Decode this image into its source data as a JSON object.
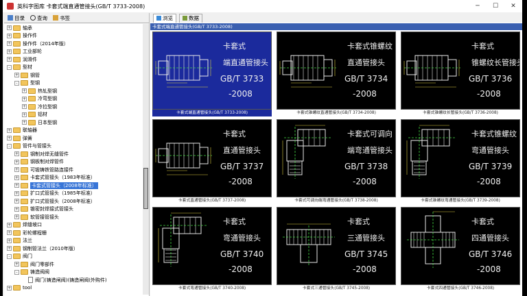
{
  "window": {
    "title": "英科字图库 卡套式端直通管接头(GB/T 3733-2008)"
  },
  "left_tabs": [
    {
      "label": "目录"
    },
    {
      "label": "查询"
    },
    {
      "label": "书签"
    }
  ],
  "tree": [
    {
      "label": "轴承",
      "exp": "+",
      "level": 0
    },
    {
      "label": "操作件",
      "exp": "+",
      "level": 0
    },
    {
      "label": "操作件（2014年版）",
      "exp": "+",
      "level": 0
    },
    {
      "label": "工业部轮",
      "exp": "+",
      "level": 0
    },
    {
      "label": "润滑件",
      "exp": "+",
      "level": 0
    },
    {
      "label": "型材",
      "exp": "-",
      "level": 0
    },
    {
      "label": "钢管",
      "exp": "+",
      "level": 1
    },
    {
      "label": "型钢",
      "exp": "-",
      "level": 1
    },
    {
      "label": "热轧型钢",
      "exp": "+",
      "level": 2
    },
    {
      "label": "冷弯型钢",
      "exp": "+",
      "level": 2
    },
    {
      "label": "冷拉型钢",
      "exp": "+",
      "level": 2
    },
    {
      "label": "铝材",
      "exp": "+",
      "level": 2
    },
    {
      "label": "日本型钢",
      "exp": "+",
      "level": 2
    },
    {
      "label": "联轴器",
      "exp": "+",
      "level": 0
    },
    {
      "label": "弹簧",
      "exp": "+",
      "level": 0
    },
    {
      "label": "管件与管接头",
      "exp": "-",
      "level": 0
    },
    {
      "label": "钢制对焊无缝管件",
      "exp": "+",
      "level": 1
    },
    {
      "label": "钢板制对焊管件",
      "exp": "+",
      "level": 1
    },
    {
      "label": "可锻铸铁管路连接件",
      "exp": "+",
      "level": 1
    },
    {
      "label": "卡套式管接头（1983年标准）",
      "exp": "+",
      "level": 1
    },
    {
      "label": "卡套式管接头（2008年标准）",
      "exp": "+",
      "level": 1,
      "selected": true
    },
    {
      "label": "扩口式管接头（1985年标准）",
      "exp": "+",
      "level": 1
    },
    {
      "label": "扩口式管接头（2008年标准）",
      "exp": "+",
      "level": 1
    },
    {
      "label": "锥密封焊接式管接头",
      "exp": "+",
      "level": 1
    },
    {
      "label": "软管接管接头",
      "exp": "+",
      "level": 1
    },
    {
      "label": "焊缝坡口",
      "exp": "+",
      "level": 0
    },
    {
      "label": "彩轮螺程栅",
      "exp": "+",
      "level": 0
    },
    {
      "label": "法兰",
      "exp": "+",
      "level": 0
    },
    {
      "label": "钢制管法兰（2010年版）",
      "exp": "+",
      "level": 0
    },
    {
      "label": "阀门",
      "exp": "-",
      "level": 0
    },
    {
      "label": "阀门零部件",
      "exp": "+",
      "level": 1
    },
    {
      "label": "铸造阀阀",
      "exp": "-",
      "level": 1
    },
    {
      "label": "阀门(铸造闸阀)(铸造闸阀(外购件)",
      "exp": "",
      "level": 2,
      "doc": true
    },
    {
      "label": "tool",
      "exp": "+",
      "level": 0
    }
  ],
  "right_tabs": [
    {
      "label": "浏览"
    },
    {
      "label": "数据"
    }
  ],
  "breadcrumb": "卡套式端直通管接头(GB/T 3733-2008)",
  "items": [
    {
      "line1": "卡套式",
      "line2": "端直通管接头",
      "std": "GB/T 3733",
      "year": "-2008",
      "caption": "卡套式端直通管接头(GB/T 3733-2008)",
      "active": true,
      "shape": "straight"
    },
    {
      "line1": "卡套式锥螺纹",
      "line2": "直通管接头",
      "std": "GB/T 3734",
      "year": "-2008",
      "caption": "卡套式锥螺纹直通管接头(GB/T 3734-2008)",
      "shape": "straight"
    },
    {
      "line1": "卡套式",
      "line2": "锥螺纹长管接头",
      "std": "GB/T 3736",
      "year": "-2008",
      "caption": "卡套式锥螺纹长管接头(GB/T 3736-2008)",
      "shape": "straight"
    },
    {
      "line1": "卡套式",
      "line2": "直通管接头",
      "std": "GB/T 3737",
      "year": "-2008",
      "caption": "卡套式直通管接头(GB/T 3737-2008)",
      "shape": "straight"
    },
    {
      "line1": "卡套式可调向",
      "line2": "端弯通管接头",
      "std": "GB/T 3738",
      "year": "-2008",
      "caption": "卡套式可调向端弯通管接头(GB/T 3738-2008)",
      "shape": "elbow"
    },
    {
      "line1": "卡套式锥螺纹",
      "line2": "弯通管接头",
      "std": "GB/T 3739",
      "year": "-2008",
      "caption": "卡套式锥螺纹弯通管接头(GB/T 3739-2008)",
      "shape": "elbow"
    },
    {
      "line1": "卡套式",
      "line2": "弯通管接头",
      "std": "GB/T 3740",
      "year": "-2008",
      "caption": "卡套式弯通管接头(GB/T 3740-2008)",
      "shape": "elbow"
    },
    {
      "line1": "卡套式",
      "line2": "三通管接头",
      "std": "GB/T 3745",
      "year": "-2008",
      "caption": "卡套式三通管接头(GB/T 3745-2008)",
      "shape": "tee"
    },
    {
      "line1": "卡套式",
      "line2": "四通管接头",
      "std": "GB/T 3746",
      "year": "-2008",
      "caption": "卡套式四通管接头(GB/T 3746-2008)",
      "shape": "cross"
    }
  ],
  "dims": {
    "d": "d",
    "D0": "D0",
    "L4": "L4",
    "L6c": "L6c",
    "L7c": "L7c",
    "L2": "L2",
    "L3": "L3",
    "l": "l"
  },
  "colors": {
    "accent": "#1b2a9c",
    "selection": "#3875d7",
    "folder": "#f2c55c"
  }
}
